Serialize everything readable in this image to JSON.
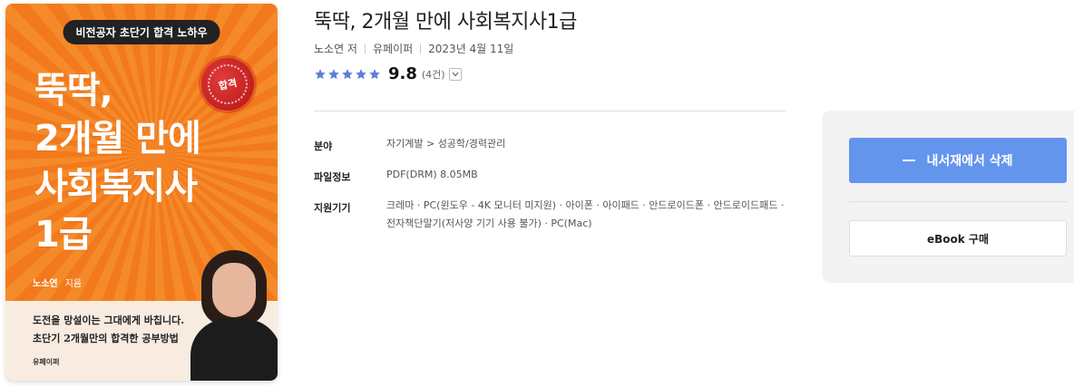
{
  "cover": {
    "badge": "비전공자 초단기 합격 노하우",
    "title": "뚝딱,\n2개월 만에\n사회복지사\n1급",
    "seal_text": "합격",
    "author": "노소연",
    "author_role": "지음",
    "tagline": "도전을 망설이는 그대에게 바칩니다.\n초단기 2개월만의 합격한 공부방법",
    "publisher": "유페이퍼",
    "colors": {
      "background": "#f58a2a",
      "bottom_band": "#f8ece1"
    }
  },
  "book": {
    "title": "뚝딱, 2개월 만에 사회복지사1급",
    "author": "노소연 저",
    "publisher": "유페이퍼",
    "date": "2023년 4월 11일",
    "rating": {
      "stars": 5,
      "score": "9.8",
      "count": "(4건)"
    },
    "star_color": "#5b7fd9"
  },
  "details": [
    {
      "label": "분야",
      "value": "자기계발 > 성공학/경력관리"
    },
    {
      "label": "파일정보",
      "value": "PDF(DRM) 8.05MB"
    },
    {
      "label": "지원기기",
      "value": "크레마 · PC(윈도우 - 4K 모니터 미지원) · 아이폰 · 아이패드 · 안드로이드폰 · 안드로이드패드 ·\n전자책단말기(저사양 기기 사용 불가) · PC(Mac)"
    }
  ],
  "actions": {
    "remove_label": "내서재에서 삭제",
    "buy_label": "eBook 구매",
    "accent": "#6495ed"
  }
}
